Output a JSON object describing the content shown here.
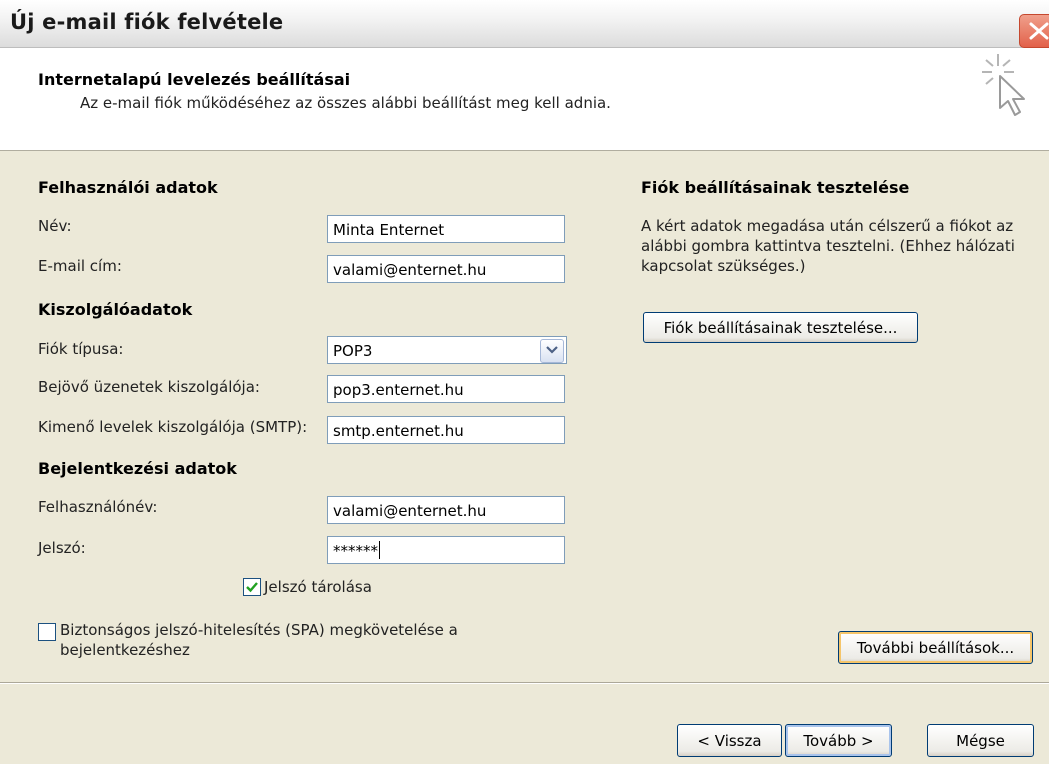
{
  "window": {
    "title": "Új e-mail fiók felvétele"
  },
  "header": {
    "title": "Internetalapú levelezés beállításai",
    "subtitle": "Az e-mail fiók működéséhez az összes alábbi beállítást meg kell adnia."
  },
  "user_section": {
    "heading": "Felhasználói adatok",
    "name_label": "Név:",
    "name_value": "Minta Enternet",
    "email_label": "E-mail cím:",
    "email_value": "valami@enternet.hu"
  },
  "server_section": {
    "heading": "Kiszolgálóadatok",
    "type_label": "Fiók típusa:",
    "type_value": "POP3",
    "incoming_label": "Bejövő üzenetek kiszolgálója:",
    "incoming_value": "pop3.enternet.hu",
    "outgoing_label": "Kimenő levelek kiszolgálója (SMTP):",
    "outgoing_value": "smtp.enternet.hu"
  },
  "login_section": {
    "heading": "Bejelentkezési adatok",
    "username_label": "Felhasználónév:",
    "username_value": "valami@enternet.hu",
    "password_label": "Jelszó:",
    "password_value": "******",
    "remember_label": "Jelszó tárolása",
    "remember_checked": true,
    "spa_label_line1": "Biztonságos jelszó-hitelesítés (SPA) megkövetelése a",
    "spa_label_line2": "bejelentkezéshez",
    "spa_checked": false
  },
  "test_section": {
    "heading": "Fiók beállításainak tesztelése",
    "desc_line1": "A kért adatok megadása után célszerű a fiókot az",
    "desc_line2": "alábbi gombra kattintva tesztelni. (Ehhez hálózati",
    "desc_line3": "kapcsolat szükséges.)",
    "test_button": "Fiók beállításainak tesztelése...",
    "more_button": "További beállítások..."
  },
  "footer": {
    "back_button": "< Vissza",
    "next_button": "Tovább >",
    "cancel_button": "Mégse"
  }
}
